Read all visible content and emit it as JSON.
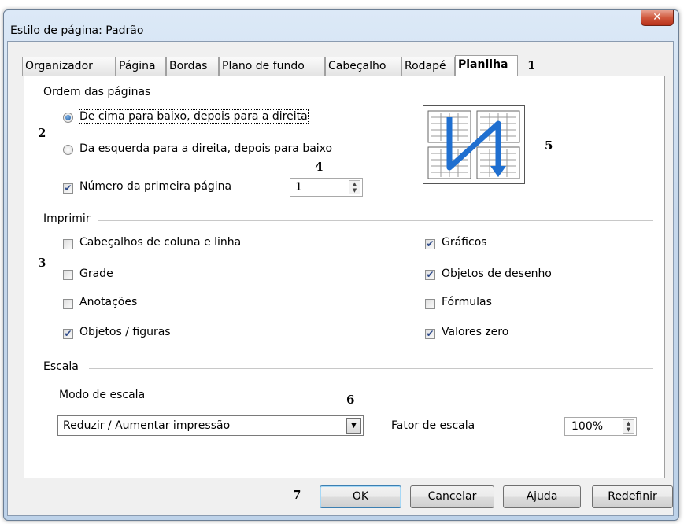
{
  "window": {
    "title": "Estilo de página: Padrão",
    "close_glyph": "✕"
  },
  "tabs": [
    {
      "label": "Organizador"
    },
    {
      "label": "Página"
    },
    {
      "label": "Bordas"
    },
    {
      "label": "Plano de fundo"
    },
    {
      "label": "Cabeçalho"
    },
    {
      "label": "Rodapé"
    },
    {
      "label": "Planilha",
      "active": true
    }
  ],
  "markers": [
    "1",
    "2",
    "3",
    "4",
    "5",
    "6",
    "7"
  ],
  "page_order": {
    "section_title": "Ordem das páginas",
    "option_top_bottom": {
      "label": "De cima para baixo, depois para a direita",
      "selected": true
    },
    "option_left_right": {
      "label": "Da esquerda para a direita, depois para baixo",
      "selected": false
    },
    "first_page_number": {
      "label": "Número da primeira página",
      "checked": true,
      "value": "1"
    }
  },
  "print": {
    "section_title": "Imprimir",
    "left": [
      {
        "label": "Cabeçalhos de coluna e linha",
        "checked": false
      },
      {
        "label": "Grade",
        "checked": false
      },
      {
        "label": "Anotações",
        "checked": false
      },
      {
        "label": "Objetos / figuras",
        "checked": true
      }
    ],
    "right": [
      {
        "label": "Gráficos",
        "checked": true
      },
      {
        "label": "Objetos de desenho",
        "checked": true
      },
      {
        "label": "Fórmulas",
        "checked": false
      },
      {
        "label": "Valores zero",
        "checked": true
      }
    ]
  },
  "scale": {
    "section_title": "Escala",
    "mode_label": "Modo de escala",
    "mode_value": "Reduzir / Aumentar impressão",
    "factor_label": "Fator de escala",
    "factor_value": "100%"
  },
  "buttons": {
    "ok": "OK",
    "cancel": "Cancelar",
    "help": "Ajuda",
    "reset": "Redefinir"
  },
  "colors": {
    "preview_arrow": "#1f6fd0",
    "accent": "#2d4a8a"
  },
  "icons": {
    "checkmark": "✔",
    "dropdown": "▼",
    "spin_up": "▲",
    "spin_down": "▼"
  }
}
